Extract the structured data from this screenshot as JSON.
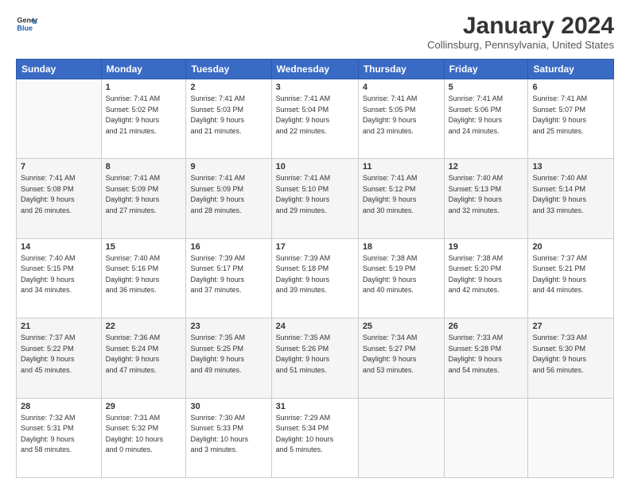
{
  "header": {
    "logo_line1": "General",
    "logo_line2": "Blue",
    "month_title": "January 2024",
    "location": "Collinsburg, Pennsylvania, United States"
  },
  "days_of_week": [
    "Sunday",
    "Monday",
    "Tuesday",
    "Wednesday",
    "Thursday",
    "Friday",
    "Saturday"
  ],
  "weeks": [
    [
      {
        "day": "",
        "info": ""
      },
      {
        "day": "1",
        "info": "Sunrise: 7:41 AM\nSunset: 5:02 PM\nDaylight: 9 hours\nand 21 minutes."
      },
      {
        "day": "2",
        "info": "Sunrise: 7:41 AM\nSunset: 5:03 PM\nDaylight: 9 hours\nand 21 minutes."
      },
      {
        "day": "3",
        "info": "Sunrise: 7:41 AM\nSunset: 5:04 PM\nDaylight: 9 hours\nand 22 minutes."
      },
      {
        "day": "4",
        "info": "Sunrise: 7:41 AM\nSunset: 5:05 PM\nDaylight: 9 hours\nand 23 minutes."
      },
      {
        "day": "5",
        "info": "Sunrise: 7:41 AM\nSunset: 5:06 PM\nDaylight: 9 hours\nand 24 minutes."
      },
      {
        "day": "6",
        "info": "Sunrise: 7:41 AM\nSunset: 5:07 PM\nDaylight: 9 hours\nand 25 minutes."
      }
    ],
    [
      {
        "day": "7",
        "info": "Sunrise: 7:41 AM\nSunset: 5:08 PM\nDaylight: 9 hours\nand 26 minutes."
      },
      {
        "day": "8",
        "info": "Sunrise: 7:41 AM\nSunset: 5:09 PM\nDaylight: 9 hours\nand 27 minutes."
      },
      {
        "day": "9",
        "info": "Sunrise: 7:41 AM\nSunset: 5:09 PM\nDaylight: 9 hours\nand 28 minutes."
      },
      {
        "day": "10",
        "info": "Sunrise: 7:41 AM\nSunset: 5:10 PM\nDaylight: 9 hours\nand 29 minutes."
      },
      {
        "day": "11",
        "info": "Sunrise: 7:41 AM\nSunset: 5:12 PM\nDaylight: 9 hours\nand 30 minutes."
      },
      {
        "day": "12",
        "info": "Sunrise: 7:40 AM\nSunset: 5:13 PM\nDaylight: 9 hours\nand 32 minutes."
      },
      {
        "day": "13",
        "info": "Sunrise: 7:40 AM\nSunset: 5:14 PM\nDaylight: 9 hours\nand 33 minutes."
      }
    ],
    [
      {
        "day": "14",
        "info": "Sunrise: 7:40 AM\nSunset: 5:15 PM\nDaylight: 9 hours\nand 34 minutes."
      },
      {
        "day": "15",
        "info": "Sunrise: 7:40 AM\nSunset: 5:16 PM\nDaylight: 9 hours\nand 36 minutes."
      },
      {
        "day": "16",
        "info": "Sunrise: 7:39 AM\nSunset: 5:17 PM\nDaylight: 9 hours\nand 37 minutes."
      },
      {
        "day": "17",
        "info": "Sunrise: 7:39 AM\nSunset: 5:18 PM\nDaylight: 9 hours\nand 39 minutes."
      },
      {
        "day": "18",
        "info": "Sunrise: 7:38 AM\nSunset: 5:19 PM\nDaylight: 9 hours\nand 40 minutes."
      },
      {
        "day": "19",
        "info": "Sunrise: 7:38 AM\nSunset: 5:20 PM\nDaylight: 9 hours\nand 42 minutes."
      },
      {
        "day": "20",
        "info": "Sunrise: 7:37 AM\nSunset: 5:21 PM\nDaylight: 9 hours\nand 44 minutes."
      }
    ],
    [
      {
        "day": "21",
        "info": "Sunrise: 7:37 AM\nSunset: 5:22 PM\nDaylight: 9 hours\nand 45 minutes."
      },
      {
        "day": "22",
        "info": "Sunrise: 7:36 AM\nSunset: 5:24 PM\nDaylight: 9 hours\nand 47 minutes."
      },
      {
        "day": "23",
        "info": "Sunrise: 7:35 AM\nSunset: 5:25 PM\nDaylight: 9 hours\nand 49 minutes."
      },
      {
        "day": "24",
        "info": "Sunrise: 7:35 AM\nSunset: 5:26 PM\nDaylight: 9 hours\nand 51 minutes."
      },
      {
        "day": "25",
        "info": "Sunrise: 7:34 AM\nSunset: 5:27 PM\nDaylight: 9 hours\nand 53 minutes."
      },
      {
        "day": "26",
        "info": "Sunrise: 7:33 AM\nSunset: 5:28 PM\nDaylight: 9 hours\nand 54 minutes."
      },
      {
        "day": "27",
        "info": "Sunrise: 7:33 AM\nSunset: 5:30 PM\nDaylight: 9 hours\nand 56 minutes."
      }
    ],
    [
      {
        "day": "28",
        "info": "Sunrise: 7:32 AM\nSunset: 5:31 PM\nDaylight: 9 hours\nand 58 minutes."
      },
      {
        "day": "29",
        "info": "Sunrise: 7:31 AM\nSunset: 5:32 PM\nDaylight: 10 hours\nand 0 minutes."
      },
      {
        "day": "30",
        "info": "Sunrise: 7:30 AM\nSunset: 5:33 PM\nDaylight: 10 hours\nand 3 minutes."
      },
      {
        "day": "31",
        "info": "Sunrise: 7:29 AM\nSunset: 5:34 PM\nDaylight: 10 hours\nand 5 minutes."
      },
      {
        "day": "",
        "info": ""
      },
      {
        "day": "",
        "info": ""
      },
      {
        "day": "",
        "info": ""
      }
    ]
  ]
}
